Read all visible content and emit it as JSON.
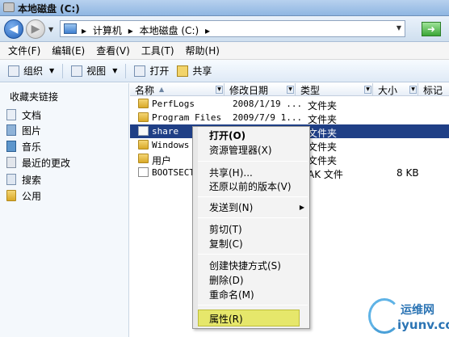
{
  "window": {
    "title": "本地磁盘 (C:)"
  },
  "address": {
    "crumbs": [
      "▸",
      "计算机",
      "▸",
      "本地磁盘 (C:)",
      "▸"
    ]
  },
  "menubar": {
    "items": [
      "文件(F)",
      "编辑(E)",
      "查看(V)",
      "工具(T)",
      "帮助(H)"
    ]
  },
  "toolbar": {
    "organize": "组织",
    "views": "视图",
    "open": "打开",
    "share": "共享"
  },
  "sidebar": {
    "header": "收藏夹链接",
    "items": [
      {
        "label": "文档",
        "icon": "document-icon"
      },
      {
        "label": "图片",
        "icon": "picture-icon"
      },
      {
        "label": "音乐",
        "icon": "music-icon"
      },
      {
        "label": "最近的更改",
        "icon": "recent-icon"
      },
      {
        "label": "搜索",
        "icon": "search-icon"
      },
      {
        "label": "公用",
        "icon": "folder-icon"
      }
    ]
  },
  "columns": [
    "名称",
    "修改日期",
    "类型",
    "大小",
    "标记"
  ],
  "files": [
    {
      "name": "PerfLogs",
      "date": "2008/1/19 ...",
      "type": "文件夹",
      "size": "",
      "icon": "folder",
      "selected": false
    },
    {
      "name": "Program Files",
      "date": "2009/7/9 1...",
      "type": "文件夹",
      "size": "",
      "icon": "folder",
      "selected": false
    },
    {
      "name": "share",
      "date": "",
      "type": "文件夹",
      "size": "",
      "icon": "share",
      "selected": true
    },
    {
      "name": "Windows",
      "date": "",
      "type": "文件夹",
      "size": "",
      "icon": "folder",
      "selected": false
    },
    {
      "name": "用户",
      "date": "",
      "type": "文件夹",
      "size": "",
      "icon": "folder",
      "selected": false
    },
    {
      "name": "BOOTSECT.",
      "date": "",
      "type": "AK 文件",
      "size": "8 KB",
      "icon": "file",
      "selected": false
    }
  ],
  "context_menu": {
    "items": [
      "打开(O)",
      "资源管理器(X)",
      "共享(H)...",
      "还原以前的版本(V)",
      "发送到(N)",
      "剪切(T)",
      "复制(C)",
      "创建快捷方式(S)",
      "删除(D)",
      "重命名(M)",
      "属性(R)"
    ],
    "highlighted": "属性(R)"
  },
  "watermark": {
    "line1": "运维网",
    "line2": "iyunv.com"
  }
}
